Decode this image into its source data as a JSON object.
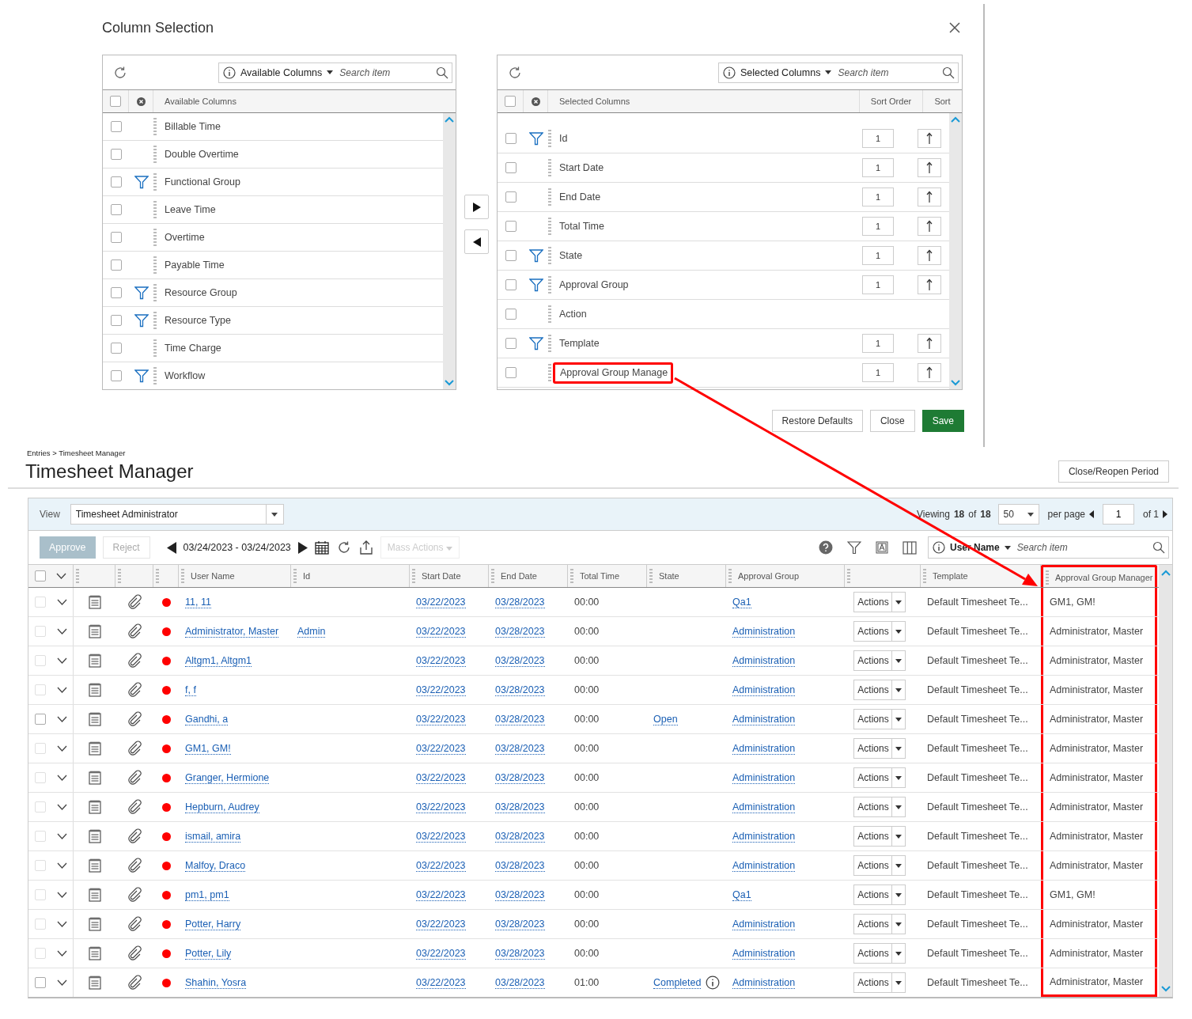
{
  "dialog": {
    "title": "Column Selection",
    "available": {
      "dropdown": "Available Columns",
      "placeholder": "Search item",
      "header": "Available Columns",
      "select_all_checked": false,
      "items": [
        {
          "label": "Billable Time",
          "filter": false,
          "checked": false
        },
        {
          "label": "Double Overtime",
          "filter": false,
          "checked": false
        },
        {
          "label": "Functional Group",
          "filter": true,
          "checked": false
        },
        {
          "label": "Leave Time",
          "filter": false,
          "checked": false
        },
        {
          "label": "Overtime",
          "filter": false,
          "checked": false
        },
        {
          "label": "Payable Time",
          "filter": false,
          "checked": false
        },
        {
          "label": "Resource Group",
          "filter": true,
          "checked": false
        },
        {
          "label": "Resource Type",
          "filter": true,
          "checked": false
        },
        {
          "label": "Time Charge",
          "filter": false,
          "checked": false
        },
        {
          "label": "Workflow",
          "filter": true,
          "checked": false
        }
      ]
    },
    "selected": {
      "dropdown": "Selected Columns",
      "placeholder": "Search item",
      "header": "Selected Columns",
      "select_all_checked": false,
      "sort_order_header": "Sort Order",
      "sort_header": "Sort",
      "items": [
        {
          "label": "Id",
          "filter": true,
          "checked": false,
          "sort_order": "1",
          "highlighted": false
        },
        {
          "label": "Start Date",
          "filter": false,
          "checked": false,
          "sort_order": "1",
          "highlighted": false
        },
        {
          "label": "End Date",
          "filter": false,
          "checked": false,
          "sort_order": "1",
          "highlighted": false
        },
        {
          "label": "Total Time",
          "filter": false,
          "checked": false,
          "sort_order": "1",
          "highlighted": false
        },
        {
          "label": "State",
          "filter": true,
          "checked": false,
          "sort_order": "1",
          "highlighted": false
        },
        {
          "label": "Approval Group",
          "filter": true,
          "checked": false,
          "sort_order": "1",
          "highlighted": false
        },
        {
          "label": "Action",
          "filter": false,
          "checked": false,
          "highlighted": false
        },
        {
          "label": "Template",
          "filter": true,
          "checked": false,
          "sort_order": "1",
          "highlighted": false
        },
        {
          "label": "Approval Group Manage",
          "filter": false,
          "checked": false,
          "sort_order": "1",
          "highlighted": true
        }
      ]
    },
    "buttons": [
      {
        "label": "Restore Defaults",
        "kind": "default"
      },
      {
        "label": "Close",
        "kind": "default"
      },
      {
        "label": "Save",
        "kind": "primary"
      }
    ]
  },
  "breadcrumb": "Entries > Timesheet Manager",
  "page": {
    "title": "Timesheet Manager",
    "action_button": "Close/Reopen Period"
  },
  "view": {
    "label": "View",
    "value": "Timesheet Administrator"
  },
  "pager": {
    "viewing_label": "Viewing",
    "count": "18",
    "of_label": "of",
    "total": "18",
    "per_page_value": "50",
    "per_page_label": "per page",
    "page": "1",
    "of_pages": "of 1"
  },
  "toolbar": {
    "approve": {
      "label": "Approve",
      "disabled": true
    },
    "reject": {
      "label": "Reject",
      "disabled": true
    },
    "date_range": "03/24/2023 - 03/24/2023",
    "mass_actions": {
      "label": "Mass Actions",
      "disabled": true
    },
    "search": {
      "field": "User Name",
      "placeholder": "Search item"
    }
  },
  "table": {
    "select_all_checked": false,
    "columns": [
      {
        "label": "User Name",
        "highlighted": false
      },
      {
        "label": "Id",
        "highlighted": false
      },
      {
        "label": "Start Date",
        "highlighted": false
      },
      {
        "label": "End Date",
        "highlighted": false
      },
      {
        "label": "Total Time",
        "highlighted": false
      },
      {
        "label": "State",
        "highlighted": false
      },
      {
        "label": "Approval Group",
        "highlighted": false
      },
      {
        "highlighted": false
      },
      {
        "label": "Template",
        "highlighted": false
      },
      {
        "label": "Approval Group Manager",
        "highlighted": true
      }
    ],
    "rows": [
      {
        "disabled": true,
        "color": "#ff0000",
        "user": "11, 11",
        "start": "03/22/2023",
        "end": "03/28/2023",
        "total": "00:00",
        "group": "Qa1",
        "action": "Actions",
        "template": "Default Timesheet Te...",
        "manager": "GM1, GM!"
      },
      {
        "disabled": true,
        "color": "#ff0000",
        "user": "Administrator, Master",
        "id": "Admin",
        "start": "03/22/2023",
        "end": "03/28/2023",
        "total": "00:00",
        "group": "Administration",
        "action": "Actions",
        "template": "Default Timesheet Te...",
        "manager": "Administrator, Master"
      },
      {
        "disabled": true,
        "color": "#ff0000",
        "user": "Altgm1, Altgm1",
        "start": "03/22/2023",
        "end": "03/28/2023",
        "total": "00:00",
        "group": "Administration",
        "action": "Actions",
        "template": "Default Timesheet Te...",
        "manager": "Administrator, Master"
      },
      {
        "disabled": true,
        "color": "#ff0000",
        "user": "f, f",
        "start": "03/22/2023",
        "end": "03/28/2023",
        "total": "00:00",
        "group": "Administration",
        "action": "Actions",
        "template": "Default Timesheet Te...",
        "manager": "Administrator, Master"
      },
      {
        "disabled": false,
        "color": "#ff0000",
        "user": "Gandhi, a",
        "start": "03/22/2023",
        "end": "03/28/2023",
        "total": "00:00",
        "state": "Open",
        "group": "Administration",
        "action": "Actions",
        "template": "Default Timesheet Te...",
        "manager": "Administrator, Master"
      },
      {
        "disabled": true,
        "color": "#ff0000",
        "user": "GM1, GM!",
        "start": "03/22/2023",
        "end": "03/28/2023",
        "total": "00:00",
        "group": "Administration",
        "action": "Actions",
        "template": "Default Timesheet Te...",
        "manager": "Administrator, Master"
      },
      {
        "disabled": true,
        "color": "#ff0000",
        "user": "Granger, Hermione",
        "start": "03/22/2023",
        "end": "03/28/2023",
        "total": "00:00",
        "group": "Administration",
        "action": "Actions",
        "template": "Default Timesheet Te...",
        "manager": "Administrator, Master"
      },
      {
        "disabled": true,
        "color": "#ff0000",
        "user": "Hepburn, Audrey",
        "start": "03/22/2023",
        "end": "03/28/2023",
        "total": "00:00",
        "group": "Administration",
        "action": "Actions",
        "template": "Default Timesheet Te...",
        "manager": "Administrator, Master"
      },
      {
        "disabled": true,
        "color": "#ff0000",
        "user": "ismail, amira",
        "start": "03/22/2023",
        "end": "03/28/2023",
        "total": "00:00",
        "group": "Administration",
        "action": "Actions",
        "template": "Default Timesheet Te...",
        "manager": "Administrator, Master"
      },
      {
        "disabled": true,
        "color": "#ff0000",
        "user": "Malfoy, Draco",
        "start": "03/22/2023",
        "end": "03/28/2023",
        "total": "00:00",
        "group": "Administration",
        "action": "Actions",
        "template": "Default Timesheet Te...",
        "manager": "Administrator, Master"
      },
      {
        "disabled": true,
        "color": "#ff0000",
        "user": "pm1, pm1",
        "start": "03/22/2023",
        "end": "03/28/2023",
        "total": "00:00",
        "group": "Qa1",
        "action": "Actions",
        "template": "Default Timesheet Te...",
        "manager": "GM1, GM!"
      },
      {
        "disabled": true,
        "color": "#ff0000",
        "user": "Potter, Harry",
        "start": "03/22/2023",
        "end": "03/28/2023",
        "total": "00:00",
        "group": "Administration",
        "action": "Actions",
        "template": "Default Timesheet Te...",
        "manager": "Administrator, Master"
      },
      {
        "disabled": true,
        "color": "#ff0000",
        "user": "Potter, Lily",
        "start": "03/22/2023",
        "end": "03/28/2023",
        "total": "00:00",
        "group": "Administration",
        "action": "Actions",
        "template": "Default Timesheet Te...",
        "manager": "Administrator, Master"
      },
      {
        "disabled": false,
        "color": "#ff0000",
        "user": "Shahin, Yosra",
        "start": "03/22/2023",
        "end": "03/28/2023",
        "total": "01:00",
        "state": "Completed",
        "state_info": true,
        "group": "Administration",
        "action": "Actions",
        "template": "Default Timesheet Te...",
        "manager": "Administrator, Master"
      }
    ]
  }
}
